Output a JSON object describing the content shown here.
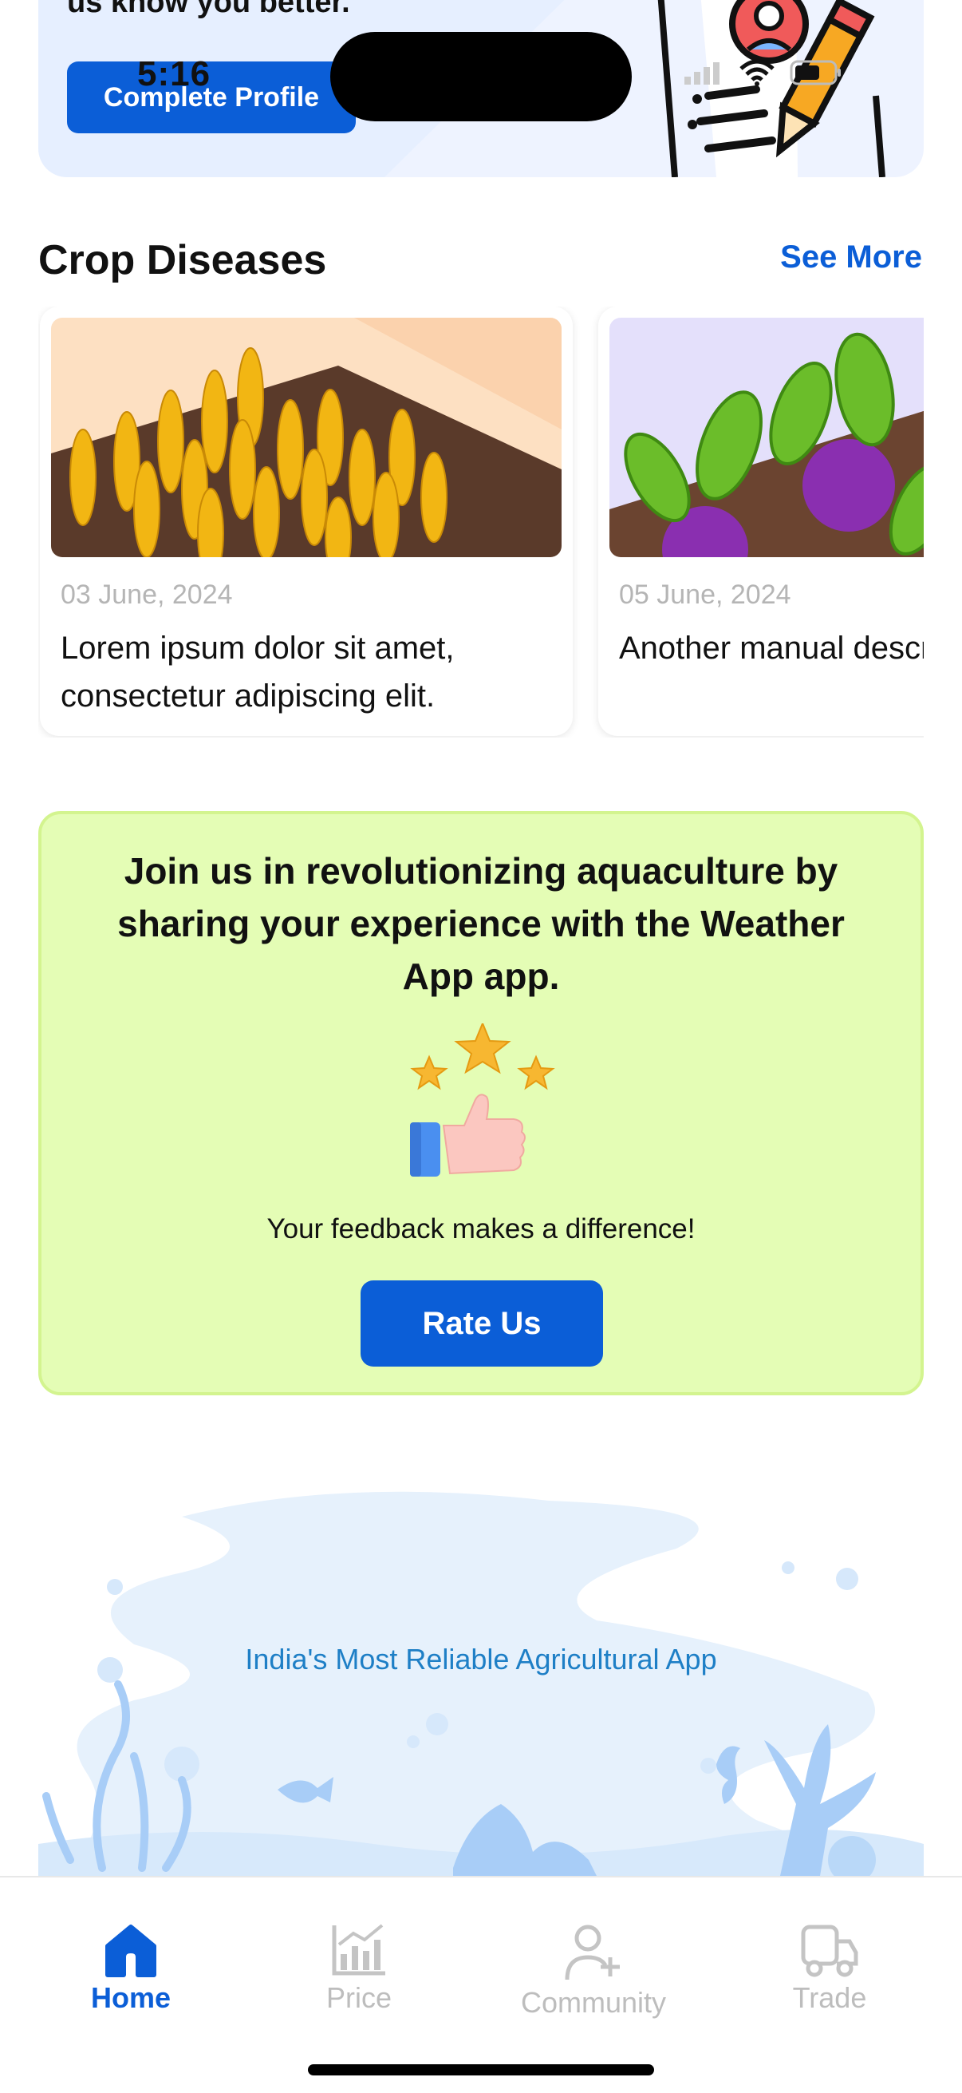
{
  "status_bar": {
    "time": "5:16"
  },
  "profile_banner": {
    "text": "us know you better.",
    "button_label": "Complete Profile"
  },
  "crop_diseases": {
    "title": "Crop Diseases",
    "see_more": "See More",
    "cards": [
      {
        "date": "03 June, 2024",
        "text": "Lorem ipsum dolor sit amet, consectetur adipiscing elit."
      },
      {
        "date": "05 June, 2024",
        "text": "Another manual description here."
      }
    ]
  },
  "rate_card": {
    "headline": "Join us in revolutionizing aquaculture by sharing your experience with the Weather App app.",
    "subtext": "Your feedback makes a difference!",
    "button_label": "Rate Us"
  },
  "footer": {
    "tagline": "India's Most Reliable Agricultural App"
  },
  "bottom_nav": {
    "items": [
      {
        "label": "Home",
        "icon": "home-icon",
        "active": true
      },
      {
        "label": "Price",
        "icon": "chart-icon",
        "active": false
      },
      {
        "label": "Community",
        "icon": "user-plus-icon",
        "active": false
      },
      {
        "label": "Trade",
        "icon": "truck-icon",
        "active": false
      }
    ]
  },
  "colors": {
    "primary": "#0b5ed7",
    "rate_card_bg": "#e4fdb5",
    "tagline": "#1e7fc6",
    "inactive_nav": "#bdbdbd"
  }
}
